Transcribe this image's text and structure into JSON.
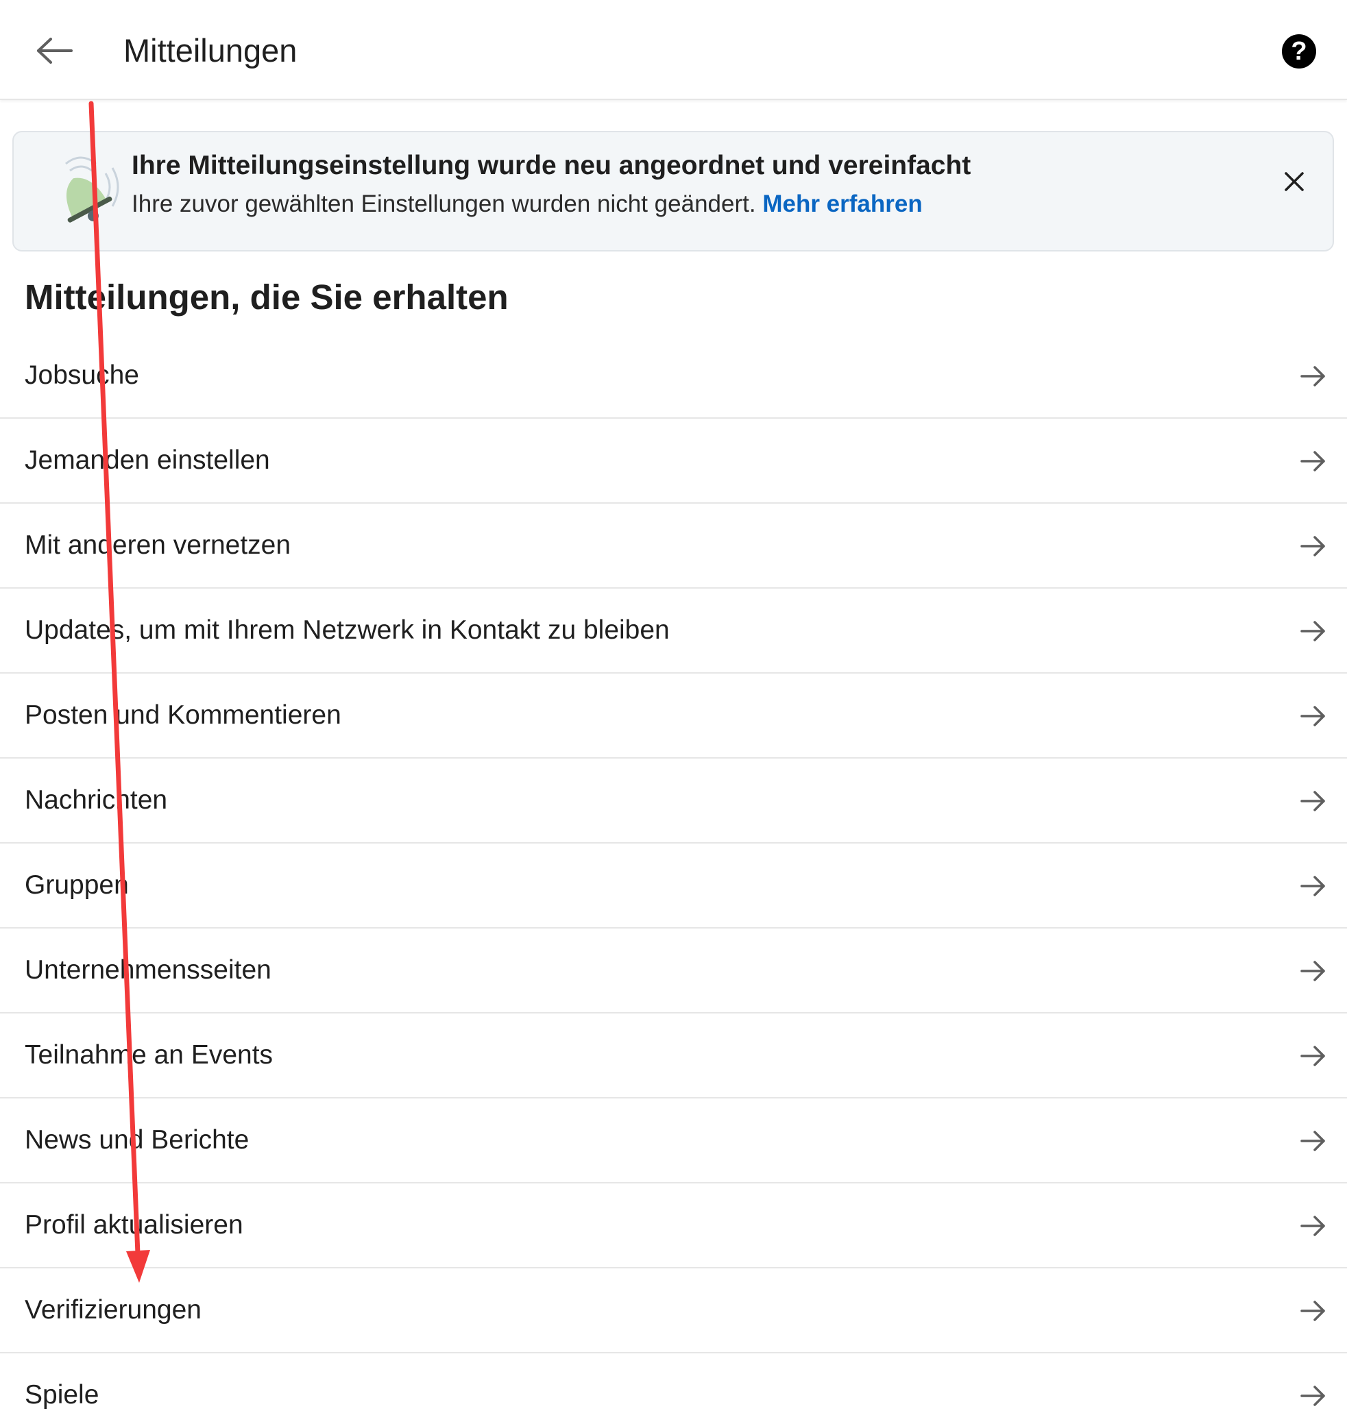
{
  "header": {
    "title": "Mitteilungen",
    "back_icon": "arrow-left-icon",
    "help_icon": "help-circle-icon",
    "help_glyph": "?"
  },
  "banner": {
    "title": "Ihre Mitteilungseinstellung wurde neu angeordnet und vereinfacht",
    "text": "Ihre zuvor gewählten Einstellungen wurden nicht geändert.",
    "link": "Mehr erfahren",
    "icon": "bell-icon",
    "close_icon": "close-icon"
  },
  "section": {
    "heading": "Mitteilungen, die Sie erhalten"
  },
  "items": [
    {
      "label": "Jobsuche"
    },
    {
      "label": "Jemanden einstellen"
    },
    {
      "label": "Mit anderen vernetzen"
    },
    {
      "label": "Updates, um mit Ihrem Netzwerk in Kontakt zu bleiben"
    },
    {
      "label": "Posten und Kommentieren"
    },
    {
      "label": "Nachrichten"
    },
    {
      "label": "Gruppen"
    },
    {
      "label": "Unternehmensseiten"
    },
    {
      "label": "Teilnahme an Events"
    },
    {
      "label": "News und Berichte"
    },
    {
      "label": "Profil aktualisieren"
    },
    {
      "label": "Verifizierungen"
    },
    {
      "label": "Spiele"
    }
  ],
  "colors": {
    "link": "#0a66c2",
    "annotation_arrow": "#f23a3a",
    "divider": "#e6e6e6",
    "banner_background": "#f3f6f8"
  }
}
